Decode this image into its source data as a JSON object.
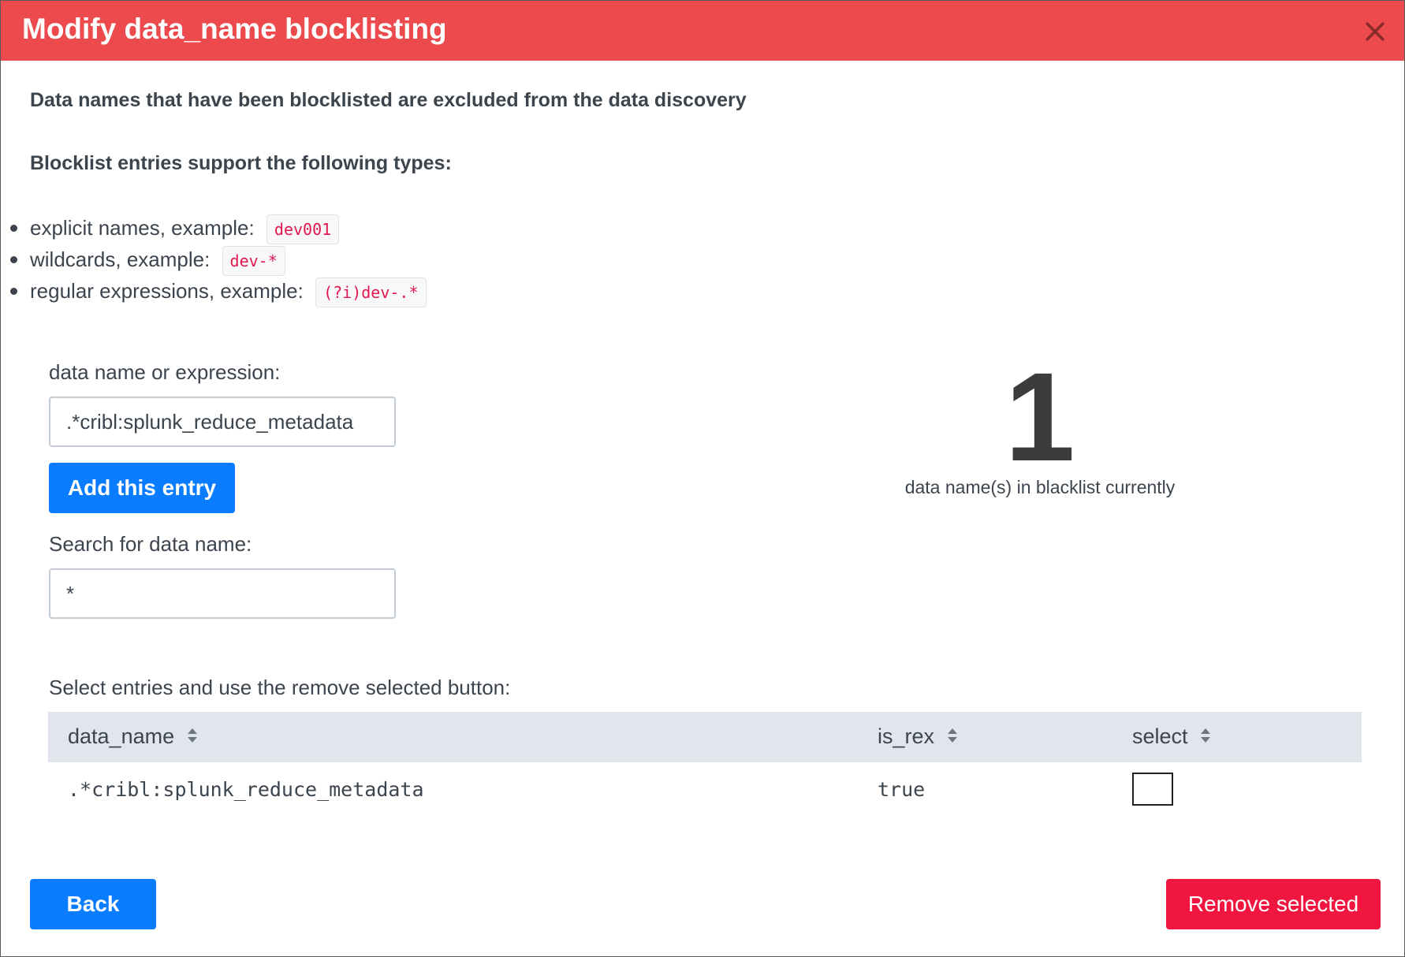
{
  "dialog": {
    "title": "Modify data_name blocklisting",
    "close_icon": "close-icon"
  },
  "intro": "Data names that have been blocklisted are excluded from the data discovery",
  "types_heading": "Blocklist entries support the following types:",
  "types": [
    {
      "label": "explicit names, example:",
      "example": "dev001"
    },
    {
      "label": "wildcards, example:",
      "example": "dev-*"
    },
    {
      "label": "regular expressions, example:",
      "example": "(?i)dev-.*"
    }
  ],
  "add_form": {
    "label": "data name or expression:",
    "value": ".*cribl:splunk_reduce_metadata",
    "button": "Add this entry"
  },
  "search": {
    "label": "Search for data name:",
    "value": "*"
  },
  "stats": {
    "count": "1",
    "caption": "data name(s) in blacklist currently"
  },
  "table": {
    "instruction": "Select entries and use the remove selected button:",
    "headers": [
      "data_name",
      "is_rex",
      "select"
    ],
    "rows": [
      {
        "data_name": ".*cribl:splunk_reduce_metadata",
        "is_rex": "true",
        "selected": false
      }
    ]
  },
  "footer": {
    "back": "Back",
    "remove": "Remove selected"
  },
  "colors": {
    "header": "#ec4a4c",
    "primary": "#0a7cff",
    "danger": "#f0163f",
    "code_text": "#e0184f"
  }
}
